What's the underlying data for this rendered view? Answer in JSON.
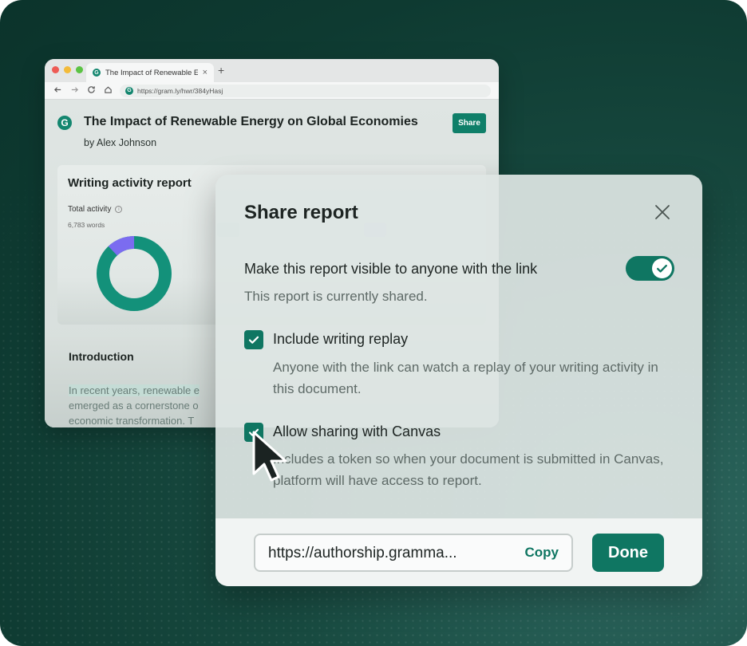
{
  "browser": {
    "tab_title": "The Impact of Renewable Ene...",
    "tab_close": "×",
    "new_tab": "+",
    "url": "https://gram.ly/hwr/384yHasj"
  },
  "document": {
    "logo_letter": "G",
    "title": "The Impact of Renewable Energy on Global Economies",
    "author": "by Alex Johnson",
    "share_label": "Share",
    "report": {
      "title": "Writing activity report",
      "total_label": "Total activity",
      "info_glyph": "i",
      "words": "6,783 words",
      "donut_fraction_purple": 0.12
    },
    "intro": {
      "title": "Introduction",
      "lines": [
        "In recent years, renewable e",
        "emerged as a cornerstone o",
        "economic transformation. T"
      ]
    }
  },
  "modal": {
    "title": "Share report",
    "visible_label": "Make this report visible to anyone with the link",
    "visible_on": true,
    "status": "This report is currently shared.",
    "options": [
      {
        "label": "Include writing replay",
        "checked": true,
        "desc": "Anyone with the link can watch a replay of your writing activity in this document."
      },
      {
        "label": "Allow sharing with Canvas",
        "checked": true,
        "desc": "Includes a token so when your document is submitted in Canvas, platform will have access to report."
      }
    ],
    "link": "https://authorship.gramma...",
    "copy_label": "Copy",
    "done_label": "Done"
  },
  "colors": {
    "brand_green": "#0f7662",
    "donut_green": "#13917a",
    "donut_purple": "#7b6cf0",
    "background": "#124238"
  }
}
